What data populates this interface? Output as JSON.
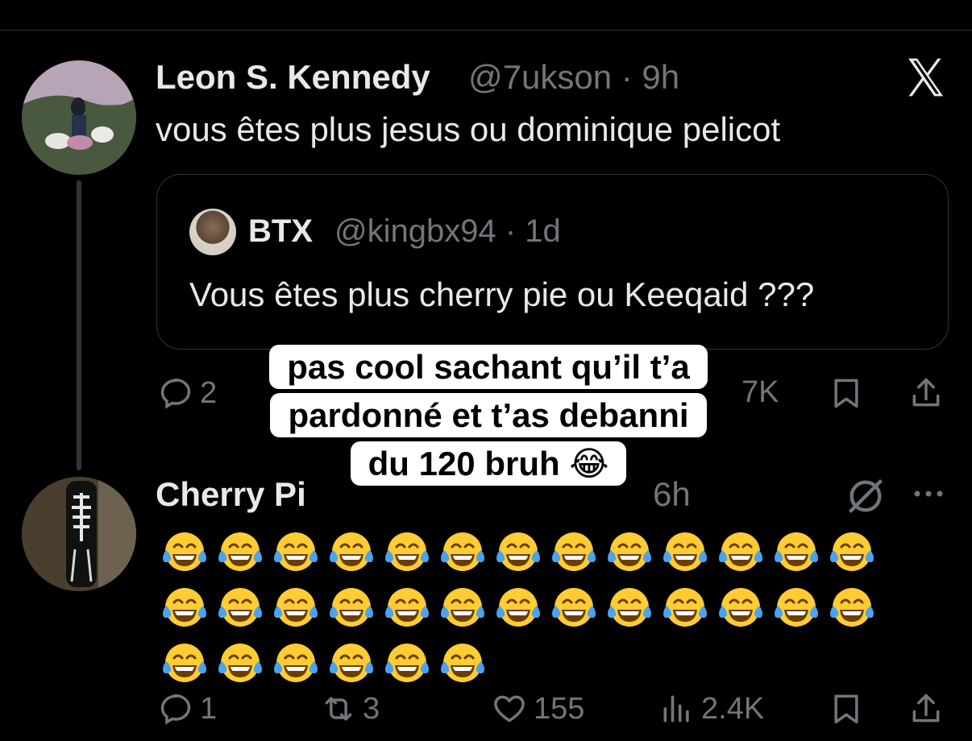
{
  "tweet1": {
    "name": "Leon S. Kennedy",
    "handle_time": "@7ukson · 9h",
    "text": "vous êtes plus jesus ou dominique pelicot"
  },
  "quote": {
    "name": "BTX",
    "handle_time": "@kingbx94 · 1d",
    "text": "Vous êtes plus cherry pie ou Keeqaid ???"
  },
  "tweet1_actions": {
    "reply_count": "2",
    "views_count": "7K"
  },
  "overlay": {
    "lines": [
      "pas cool sachant qu’il t’a",
      "pardonné et t’as debanni",
      "du 120 bruh 😂"
    ]
  },
  "tweet2": {
    "name": "Cherry Pi",
    "handle_time": "6h",
    "emoji": "😂",
    "emoji_rows": [
      13,
      13,
      6
    ]
  },
  "tweet2_actions": {
    "reply_count": "1",
    "retweet_count": "3",
    "like_count": "155",
    "views_count": "2.4K"
  },
  "icons": {
    "x_logo": "x-logo-icon",
    "reply": "reply-icon",
    "retweet": "retweet-icon",
    "like": "heart-icon",
    "views": "views-icon",
    "bookmark": "bookmark-icon",
    "share": "share-icon",
    "grok": "grok-icon",
    "more": "more-icon"
  },
  "colors": {
    "background": "#000000",
    "text_primary": "#e7e9ea",
    "text_secondary": "#71767b",
    "border": "#2f3336",
    "emoji_face": "#ffcc33"
  }
}
